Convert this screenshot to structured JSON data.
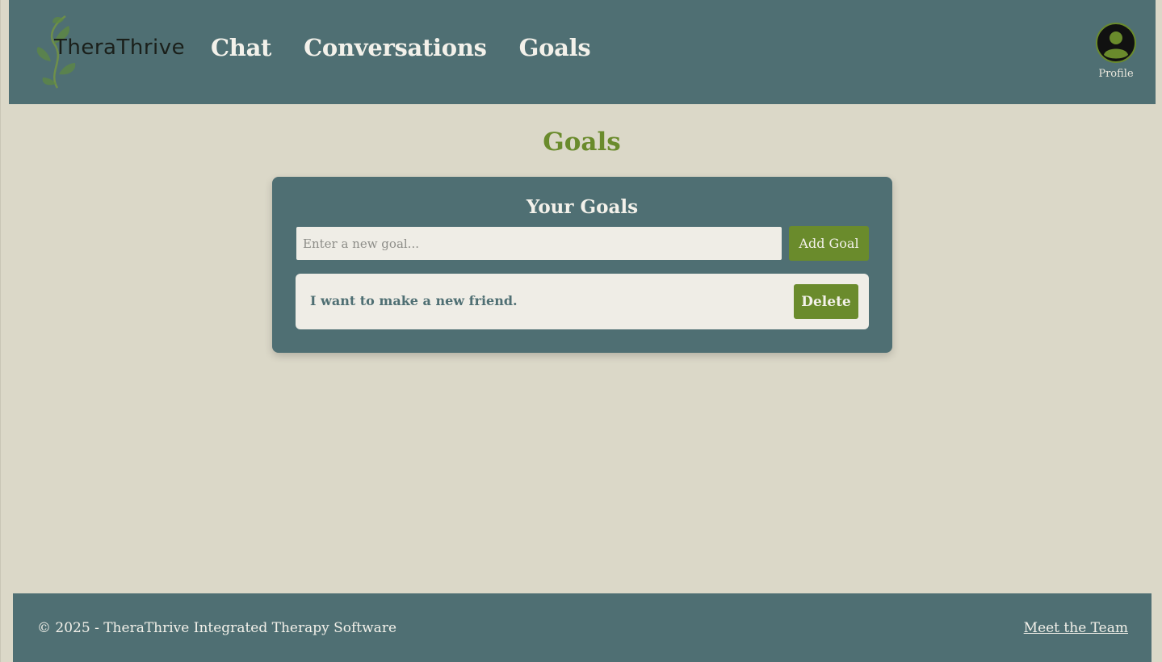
{
  "header": {
    "logo_text": "TheraThrive",
    "nav": [
      {
        "label": "Chat"
      },
      {
        "label": "Conversations"
      },
      {
        "label": "Goals"
      }
    ],
    "profile_label": "Profile"
  },
  "main": {
    "page_title": "Goals",
    "card": {
      "title": "Your Goals",
      "input_placeholder": "Enter a new goal...",
      "input_value": "",
      "add_button_label": "Add Goal",
      "goals": [
        {
          "text": "I want to make a new friend.",
          "delete_label": "Delete"
        }
      ]
    }
  },
  "footer": {
    "copyright": "© 2025 - TheraThrive Integrated Therapy Software",
    "link_label": "Meet the Team"
  },
  "colors": {
    "background": "#dbd8c8",
    "header_bg": "#4f6f73",
    "accent_green": "#6a8b2c",
    "light_surface": "#efede6"
  },
  "icons": {
    "logo": "vine-leaf-logo-icon",
    "profile": "user-avatar-icon"
  }
}
